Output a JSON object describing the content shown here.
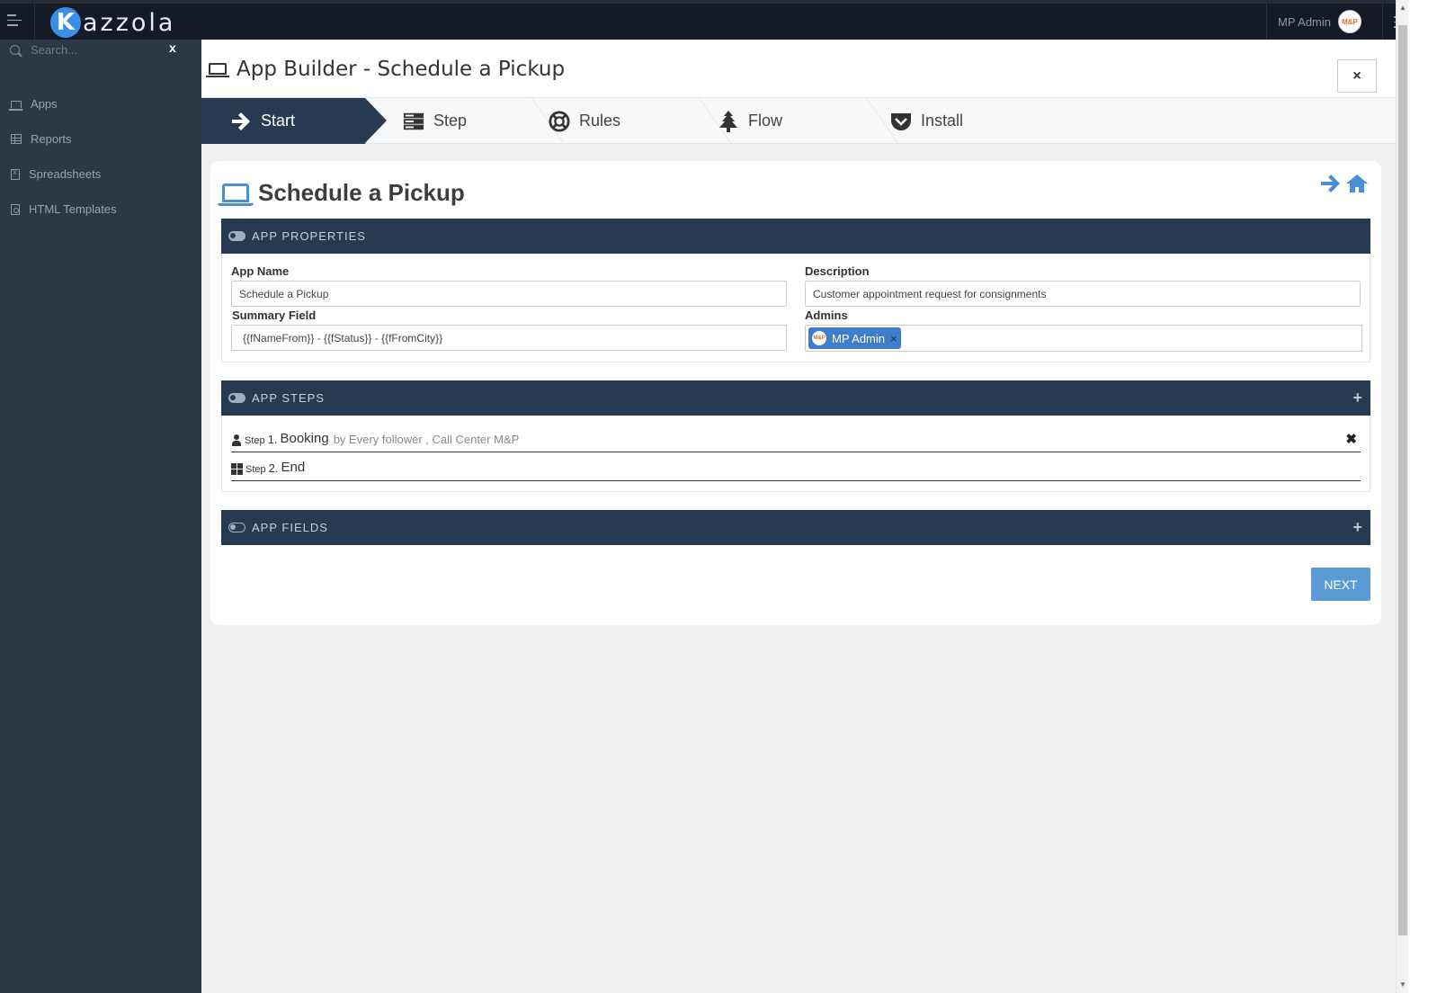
{
  "topbar": {
    "logo_letter": "K",
    "logo_text": "azzola",
    "user_name": "MP Admin",
    "avatar_text": "M&P"
  },
  "sidebar": {
    "search_placeholder": "Search...",
    "search_clear": "x",
    "items": [
      {
        "label": "Apps",
        "icon": "laptop-icon"
      },
      {
        "label": "Reports",
        "icon": "table-icon"
      },
      {
        "label": "Spreadsheets",
        "icon": "file-excel-icon"
      },
      {
        "label": "HTML Templates",
        "icon": "file-code-icon"
      }
    ]
  },
  "header": {
    "title": "App Builder - Schedule a Pickup",
    "close_label": "×"
  },
  "wizard": {
    "steps": [
      {
        "label": "Start",
        "icon": "arrow-right-icon",
        "active": true
      },
      {
        "label": "Step",
        "icon": "server-icon",
        "active": false
      },
      {
        "label": "Rules",
        "icon": "life-ring-icon",
        "active": false
      },
      {
        "label": "Flow",
        "icon": "tree-icon",
        "active": false
      },
      {
        "label": "Install",
        "icon": "pocket-icon",
        "active": false
      }
    ]
  },
  "card": {
    "title": "Schedule a Pickup",
    "properties_heading": "APP PROPERTIES",
    "app_name_label": "App Name",
    "app_name_value": "Schedule a Pickup",
    "description_label": "Description",
    "description_value": "Customer appointment request for consignments",
    "summary_label": "Summary Field",
    "summary_value": "{{fNameFrom}} - {{fStatus}} - {{fFromCity}}",
    "admins_label": "Admins",
    "admin_tag": "MP Admin",
    "admin_tag_avatar": "M&P",
    "admin_tag_remove": "×",
    "steps_heading": "APP STEPS",
    "steps": [
      {
        "prefix": "Step",
        "number": "1.",
        "name": "Booking",
        "by": "by Every follower ,  Call Center M&P",
        "icon": "user-icon"
      },
      {
        "prefix": "Step",
        "number": "2.",
        "name": "End",
        "by": "",
        "icon": "windows-icon"
      }
    ],
    "step_delete": "✖",
    "fields_heading": "APP FIELDS",
    "plus": "+",
    "next_label": "NEXT"
  },
  "colors": {
    "topbar": "#141b27",
    "sidebar": "#2b3845",
    "panel_header": "#263a52",
    "accent": "#4a8fd6",
    "next_button": "#5b9bd5"
  }
}
